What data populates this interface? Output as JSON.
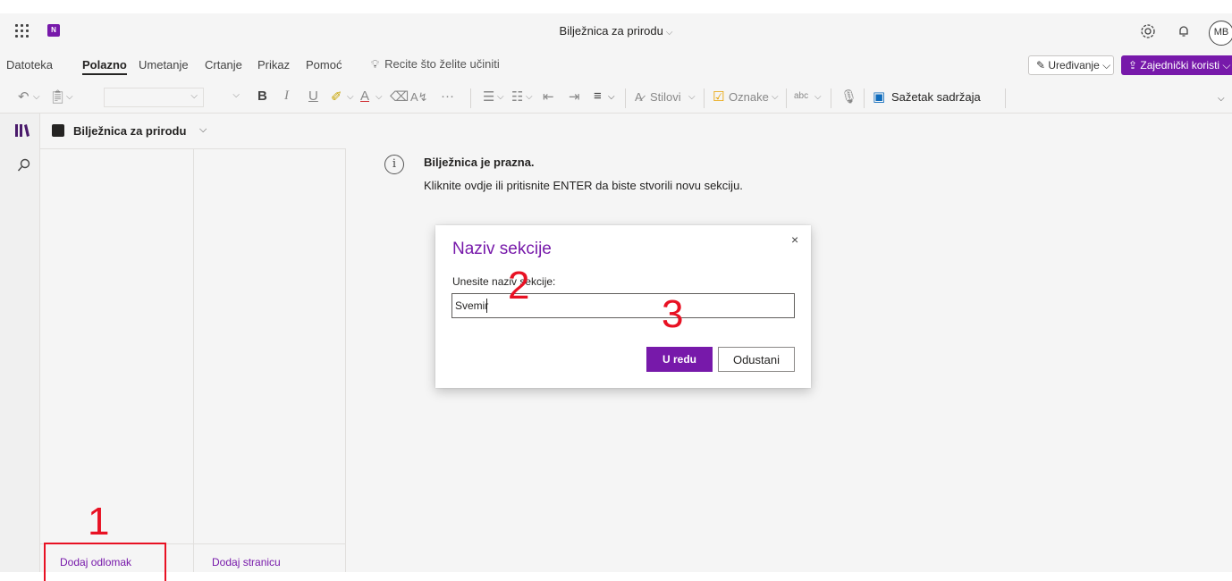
{
  "app": {
    "title": "Bilježnica za prirodu",
    "logo_letter": "N",
    "avatar_initials": "MB"
  },
  "menu": {
    "tabs": [
      "Datoteka",
      "Polazno",
      "Umetanje",
      "Crtanje",
      "Prikaz",
      "Pomoć"
    ],
    "active_tab": "Polazno",
    "tell_me": "Recite što želite učiniti",
    "edit_label": "Uređivanje",
    "share_label": "Zajednički koristi"
  },
  "ribbon": {
    "bold": "B",
    "italic": "I",
    "underline": "U",
    "font_color": "A",
    "styles_label": "Stilovi",
    "tags_label": "Oznake",
    "summary_label": "Sažetak sadržaja",
    "more": "···"
  },
  "notebook": {
    "name": "Bilježnica za prirodu",
    "add_section": "Dodaj odlomak",
    "add_page": "Dodaj stranicu"
  },
  "content": {
    "empty_title": "Bilježnica je prazna.",
    "empty_hint": "Kliknite ovdje ili pritisnite ENTER da biste stvorili novu sekciju."
  },
  "dialog": {
    "title": "Naziv sekcije",
    "label": "Unesite naziv sekcije:",
    "input_value": "Svemir",
    "ok_label": "U redu",
    "cancel_label": "Odustani",
    "close_glyph": "×"
  },
  "annotations": {
    "step1": "1",
    "step2": "2",
    "step3": "3"
  },
  "colors": {
    "accent": "#7719aa",
    "annotation": "#e81123"
  }
}
